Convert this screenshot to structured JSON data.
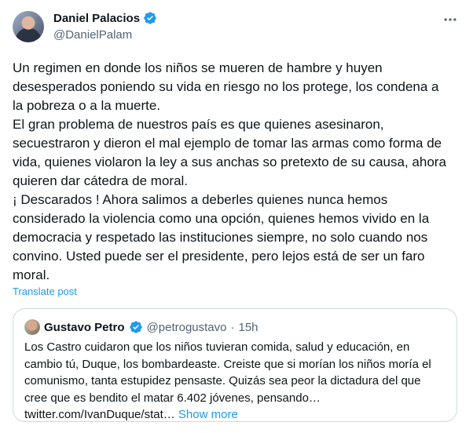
{
  "author": {
    "display_name": "Daniel Palacios",
    "handle": "@DanielPalam"
  },
  "tweet": {
    "lines": [
      "Un regimen en donde los niños se mueren de hambre y huyen",
      "desesperados poniendo su vida en riesgo no los protege, los condena a",
      "la pobreza o a la muerte.",
      "El gran problema de nuestros país es que quienes asesinaron,",
      "secuestraron y dieron el mal ejemplo de tomar las armas como forma de",
      "vida, quienes violaron la ley a sus anchas  so pretexto de su causa, ahora",
      "quieren dar cátedra de moral.",
      "¡ Descarados ! Ahora salimos a deberles quienes nunca hemos",
      "considerado la violencia como una opción, quienes hemos vivido en la",
      "democracia y respetado las instituciones siempre, no solo cuando nos",
      "convino. Usted puede ser el presidente, pero lejos está de ser un faro",
      "moral."
    ],
    "translate_label": "Translate post"
  },
  "quote": {
    "display_name": "Gustavo Petro",
    "handle": "@petrogustavo",
    "separator": "·",
    "time": "15h",
    "lines": [
      "Los Castro cuidaron que los niños tuvieran comida, salud y educación, en",
      "cambio tú, Duque, los  bombardeaste. Creiste que si morían los niños moría el",
      "comunismo, tanta  estupidez pensaste. Quizás sea peor la dictadura del que",
      "cree que es bendito el matar 6.402 jóvenes, pensando…"
    ],
    "link_text": "twitter.com/IvanDuque/stat…",
    "show_more_label": "Show more"
  },
  "icons": {
    "verified": "verified-badge-icon",
    "more": "more-options-icon"
  },
  "colors": {
    "accent": "#1d9bf0",
    "text_primary": "#0f1419",
    "text_secondary": "#536471",
    "border": "#cfd9de"
  }
}
